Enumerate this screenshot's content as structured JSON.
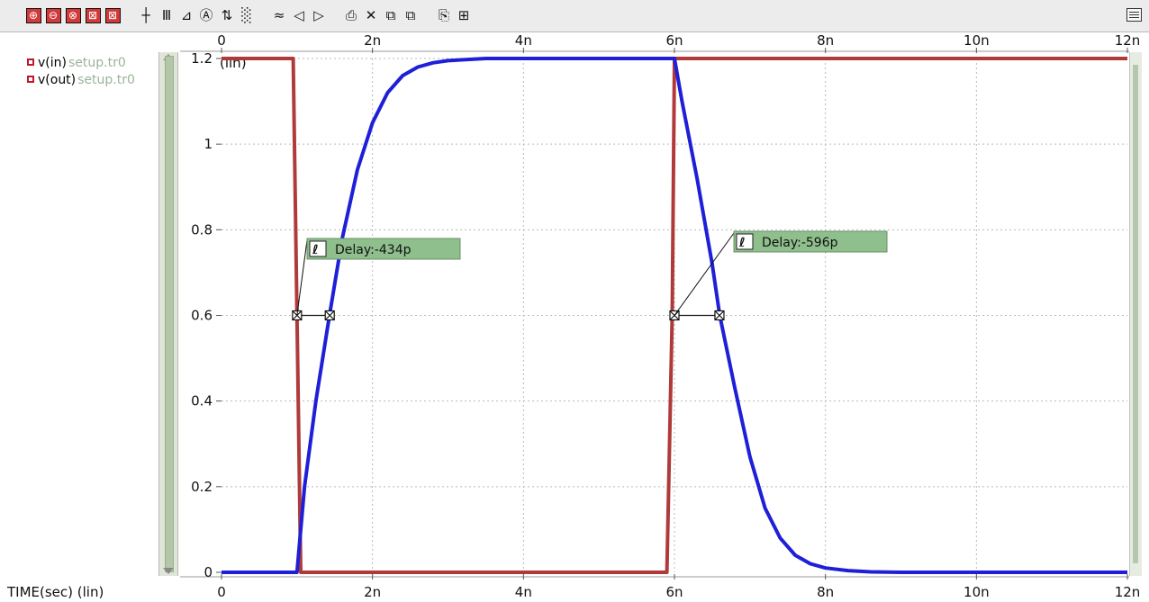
{
  "toolbar": {
    "icons": [
      "zoom-in-icon",
      "zoom-out-icon",
      "zoom-fit-icon",
      "zoom-box-icon",
      "zoom-x-icon",
      "cursor-icon",
      "grid-icon",
      "scale-icon",
      "label-icon",
      "measure-icon",
      "pattern-icon",
      "wave-icon",
      "prev-icon",
      "next-icon",
      "print-icon",
      "delete-icon",
      "copy-icon",
      "paste-icon",
      "export-icon",
      "properties-icon"
    ]
  },
  "legend": {
    "items": [
      {
        "signal": "v(in)",
        "file": "setup.tr0",
        "color": "#b03a3a"
      },
      {
        "signal": "v(out)",
        "file": "setup.tr0",
        "color": "#1f1fd8"
      }
    ]
  },
  "chart_data": {
    "type": "line",
    "xlabel": "TIME(sec) (lin)",
    "ylabel": "(lin)",
    "xlim": [
      0,
      12
    ],
    "ylim": [
      0,
      1.2
    ],
    "x_ticks": [
      0,
      2,
      4,
      6,
      8,
      10,
      12
    ],
    "x_tick_labels": [
      "0",
      "2n",
      "4n",
      "6n",
      "8n",
      "10n",
      "12n"
    ],
    "y_ticks": [
      0,
      0.2,
      0.4,
      0.6,
      0.8,
      1,
      1.2
    ],
    "y_tick_labels": [
      "0",
      "0.2",
      "0.4",
      "0.6",
      "0.8",
      "1",
      "1.2"
    ],
    "grid": true,
    "series": [
      {
        "name": "v(in)",
        "color": "#b03a3a",
        "x": [
          0,
          0.95,
          1.0,
          1.05,
          5.9,
          5.97,
          6.0,
          12
        ],
        "y": [
          1.2,
          1.2,
          0.6,
          0,
          0,
          0.6,
          1.2,
          1.2
        ]
      },
      {
        "name": "v(out)",
        "color": "#1f1fd8",
        "x": [
          0,
          0.95,
          1.0,
          1.1,
          1.25,
          1.43,
          1.6,
          1.8,
          2.0,
          2.2,
          2.4,
          2.6,
          2.8,
          3.0,
          3.5,
          4.0,
          5.0,
          6.0,
          6.1,
          6.3,
          6.5,
          6.6,
          6.8,
          7.0,
          7.2,
          7.4,
          7.6,
          7.8,
          8.0,
          8.3,
          8.6,
          9.0,
          10,
          12
        ],
        "y": [
          0,
          0,
          0,
          0.2,
          0.4,
          0.6,
          0.78,
          0.94,
          1.05,
          1.12,
          1.16,
          1.18,
          1.19,
          1.195,
          1.2,
          1.2,
          1.2,
          1.2,
          1.1,
          0.92,
          0.72,
          0.6,
          0.43,
          0.27,
          0.15,
          0.08,
          0.04,
          0.02,
          0.01,
          0.004,
          0.001,
          0,
          0,
          0
        ]
      }
    ],
    "annotations": [
      {
        "label": "Delay:-434p",
        "level": 0.6,
        "t1": 1.0,
        "t2": 1.434
      },
      {
        "label": "Delay:-596p",
        "level": 0.6,
        "t1": 6.0,
        "t2": 6.596
      }
    ]
  }
}
